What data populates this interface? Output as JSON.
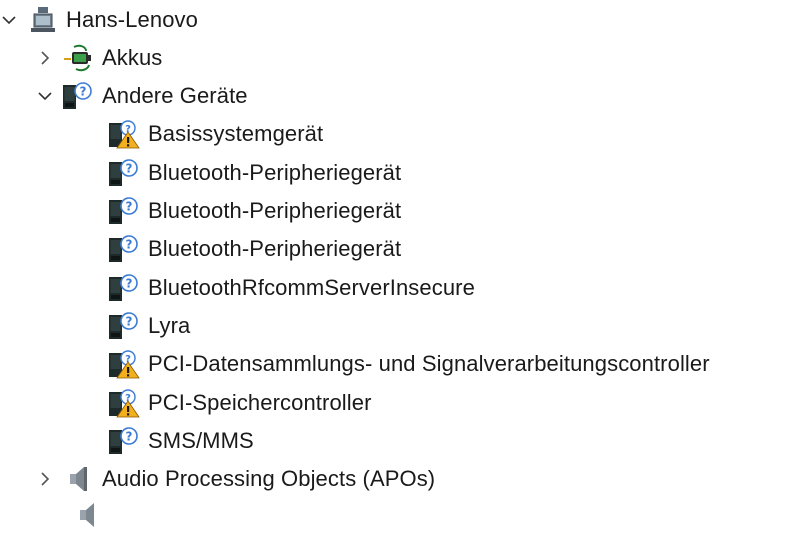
{
  "tree": {
    "root": {
      "label": "Hans-Lenovo",
      "expanded": true
    },
    "categories": [
      {
        "label": "Akkus",
        "expanded": false,
        "icon": "battery-icon"
      },
      {
        "label": "Andere Geräte",
        "expanded": true,
        "icon": "unknown-device-icon",
        "children": [
          {
            "label": "Basissystemgerät",
            "icon": "warning-device-icon"
          },
          {
            "label": "Bluetooth-Peripheriegerät",
            "icon": "unknown-device-icon"
          },
          {
            "label": "Bluetooth-Peripheriegerät",
            "icon": "unknown-device-icon"
          },
          {
            "label": "Bluetooth-Peripheriegerät",
            "icon": "unknown-device-icon"
          },
          {
            "label": "BluetoothRfcommServerInsecure",
            "icon": "unknown-device-icon"
          },
          {
            "label": "Lyra",
            "icon": "unknown-device-icon"
          },
          {
            "label": "PCI-Datensammlungs- und Signalverarbeitungscontroller",
            "icon": "warning-device-icon"
          },
          {
            "label": "PCI-Speichercontroller",
            "icon": "warning-device-icon"
          },
          {
            "label": "SMS/MMS",
            "icon": "unknown-device-icon"
          }
        ]
      },
      {
        "label": "Audio Processing Objects (APOs)",
        "expanded": false,
        "icon": "speaker-icon"
      }
    ]
  }
}
